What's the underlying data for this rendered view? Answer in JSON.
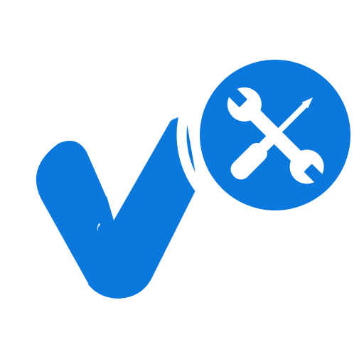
{
  "icon": {
    "name": "checkmark-with-tools-icon",
    "parts": [
      "checkmark-icon",
      "wrench-icon",
      "screwdriver-icon"
    ]
  },
  "colors": {
    "primary": "#0a78dc",
    "background": "#ffffff",
    "tool_fill": "#ffffff"
  }
}
